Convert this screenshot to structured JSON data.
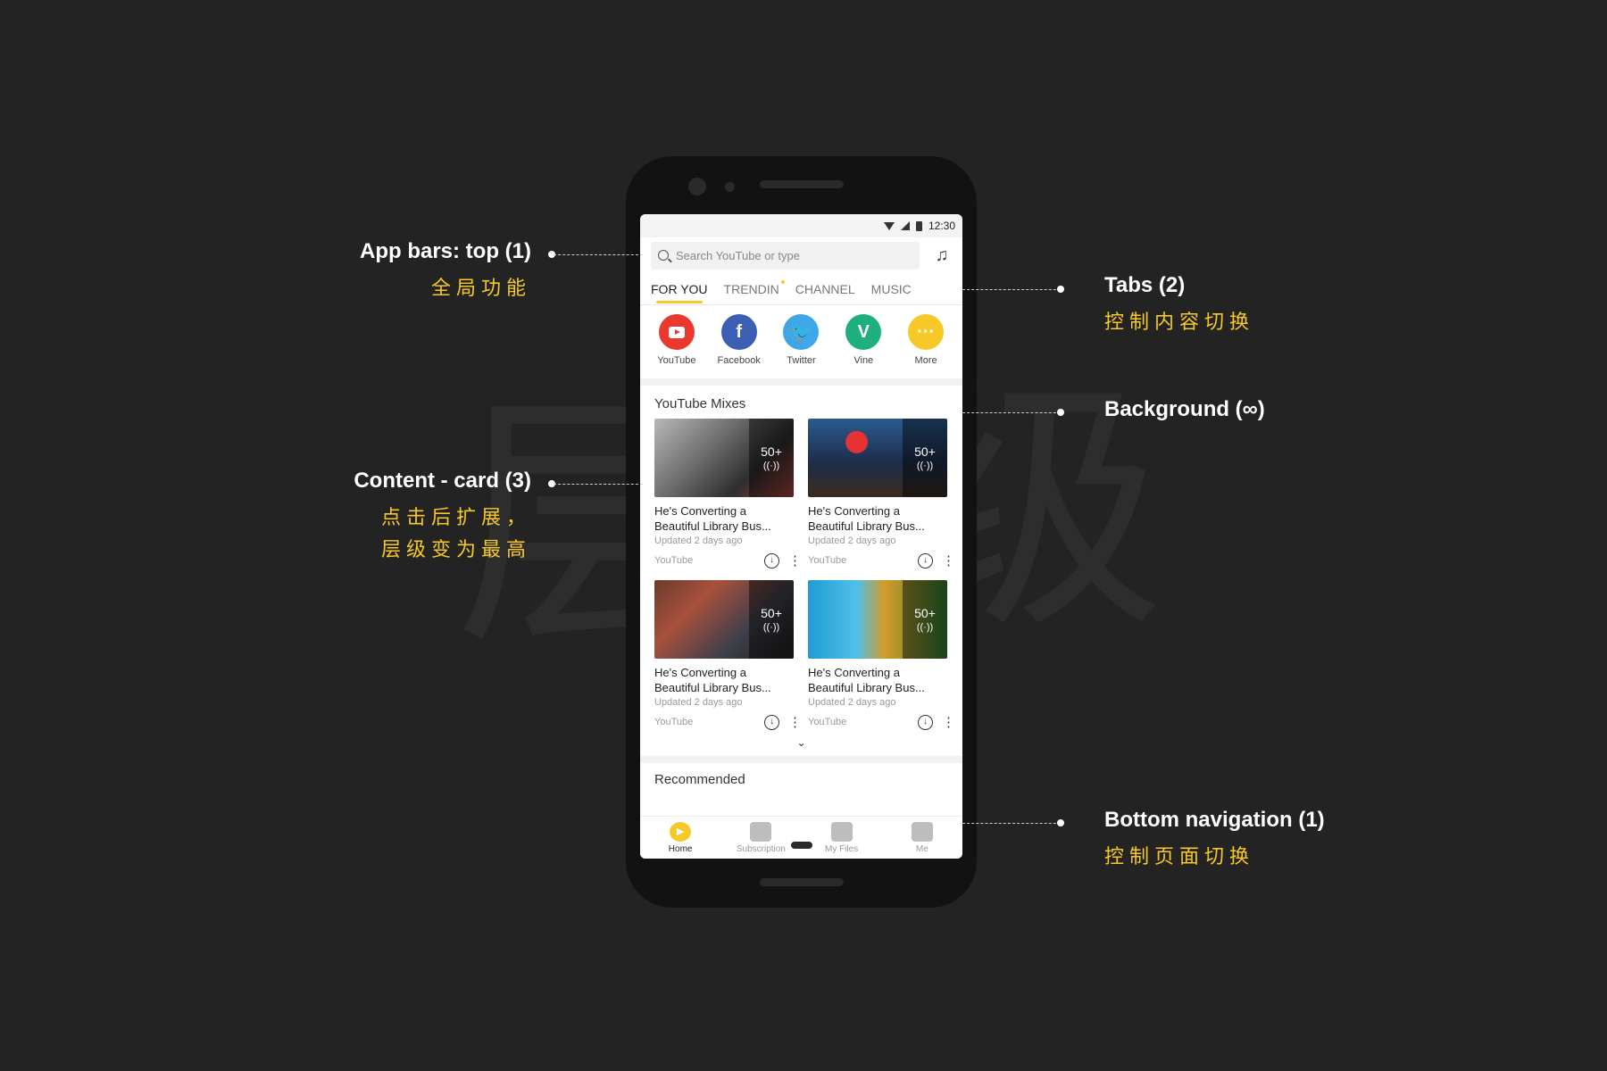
{
  "background_chars": [
    "层",
    "级"
  ],
  "annotations": {
    "top_app_bar": {
      "label": "App bars: top (1)",
      "sub": "全局功能"
    },
    "tabs": {
      "label": "Tabs (2)",
      "sub": "控制内容切换"
    },
    "background": {
      "label": "Background (∞)"
    },
    "content_card": {
      "label": "Content - card (3)",
      "sub1": "点击后扩展，",
      "sub2": "层级变为最高"
    },
    "bottom_navigation": {
      "label": "Bottom navigation (1)",
      "sub": "控制页面切换"
    }
  },
  "status_bar": {
    "time": "12:30"
  },
  "search": {
    "placeholder": "Search YouTube or type"
  },
  "tabs": [
    {
      "label": "FOR YOU",
      "active": true
    },
    {
      "label": "TRENDIN",
      "active": false,
      "dot": true
    },
    {
      "label": "CHANNEL",
      "active": false
    },
    {
      "label": "MUSIC",
      "active": false
    }
  ],
  "shortcuts": [
    {
      "label": "YouTube",
      "icon": "youtube-icon",
      "color": "#e9392f"
    },
    {
      "label": "Facebook",
      "icon": "facebook-icon",
      "glyph": "f",
      "color": "#3b5fb4"
    },
    {
      "label": "Twitter",
      "icon": "twitter-icon",
      "glyph": "🐦",
      "color": "#3fa6e7"
    },
    {
      "label": "Vine",
      "icon": "vine-icon",
      "glyph": "V",
      "color": "#1fae7e"
    },
    {
      "label": "More",
      "icon": "more-icon",
      "glyph": "···",
      "color": "#f7c928"
    }
  ],
  "section_mixes": {
    "title": "YouTube Mixes"
  },
  "cards": [
    {
      "title": "He's Converting a Beautiful Library Bus...",
      "updated": "Updated 2 days ago",
      "source": "YouTube",
      "count": "50+",
      "thumb_bg": "linear-gradient(135deg,#b8b8b8 0%,#6b6b6b 40%,#2e2e2e 70%,#a6443a 100%)"
    },
    {
      "title": "He's Converting a Beautiful Library Bus...",
      "updated": "Updated 2 days ago",
      "source": "YouTube",
      "count": "50+",
      "thumb_bg": "radial-gradient(circle at 35% 30%,#e63232 0 10%,transparent 11%),linear-gradient(180deg,#2b5b8f 0%,#1d2e4c 55%,#3a2a1e 100%)"
    },
    {
      "title": "He's Converting a Beautiful Library Bus...",
      "updated": "Updated 2 days ago",
      "source": "YouTube",
      "count": "50+",
      "thumb_bg": "linear-gradient(135deg,#6b3b2b 0%,#a8503c 30%,#3f3f49 65%,#1f1f1f 100%)"
    },
    {
      "title": "He's Converting a Beautiful Library Bus...",
      "updated": "Updated 2 days ago",
      "source": "YouTube",
      "count": "50+",
      "thumb_bg": "linear-gradient(90deg,#1f9bd6 0%,#4fc0e8 35%,#d49a2a 55%,#2e7d32 100%)"
    }
  ],
  "expand_glyph": "⌄",
  "section_recommended": {
    "title": "Recommended"
  },
  "bottom_nav": [
    {
      "label": "Home",
      "icon": "home-icon",
      "active": true,
      "color": "#f7c928"
    },
    {
      "label": "Subscription",
      "icon": "subscription-icon",
      "active": false,
      "color": "#bdbdbd"
    },
    {
      "label": "My Files",
      "icon": "my-files-icon",
      "active": false,
      "color": "#bdbdbd"
    },
    {
      "label": "Me",
      "icon": "me-icon",
      "active": false,
      "color": "#bdbdbd"
    }
  ],
  "colors": {
    "accent": "#f7c928",
    "page_bg": "#232323"
  }
}
